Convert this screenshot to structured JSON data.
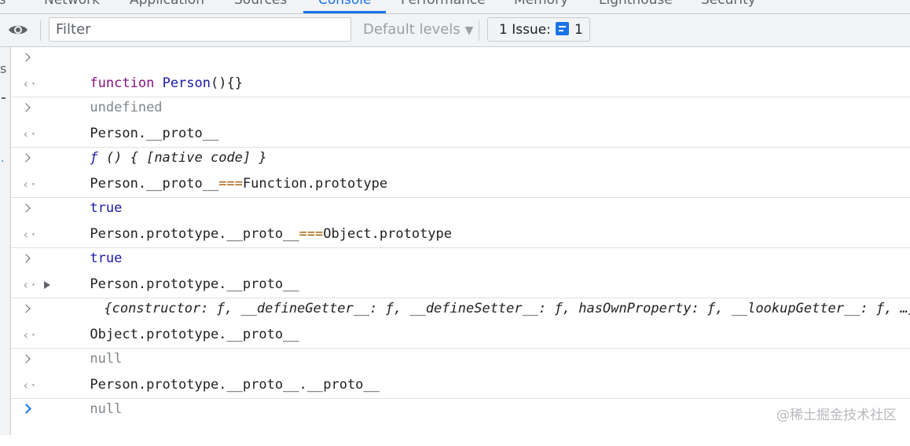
{
  "tabs": [
    "ts",
    "Network",
    "Application",
    "Sources",
    "Console",
    "Performance",
    "Memory",
    "Lighthouse",
    "Security"
  ],
  "toolbar": {
    "filter_placeholder": "Filter",
    "levels_label": "Default levels",
    "issues_label": "1 Issue:",
    "issues_count": "1"
  },
  "gutter": {
    "text": "s"
  },
  "console": {
    "entries": [
      {
        "input_parts": [
          "function",
          "Person",
          "(){}"
        ],
        "output": "undefined"
      },
      {
        "input": "Person.__proto__",
        "output_parts": [
          "ƒ",
          " () { [native code] }"
        ]
      },
      {
        "input_parts": [
          "Person.__proto__",
          "===",
          "Function.prototype"
        ],
        "output": "true"
      },
      {
        "input_parts": [
          "Person.prototype.__proto__",
          "===",
          "Object.prototype"
        ],
        "output": "true"
      },
      {
        "input": "Person.prototype.__proto__",
        "output": "{constructor: ƒ, __defineGetter__: ƒ, __defineSetter__: ƒ, hasOwnProperty: ƒ, __lookupGetter__: ƒ, …}"
      },
      {
        "input": "Object.prototype.__proto__",
        "output": "null"
      },
      {
        "input": "Person.prototype.__proto__.__proto__",
        "output": "null"
      }
    ]
  },
  "watermark": "@稀土掘金技术社区",
  "colors": {
    "accent": "#1a73e8",
    "keyword": "#881280",
    "operator": "#a05a00"
  }
}
